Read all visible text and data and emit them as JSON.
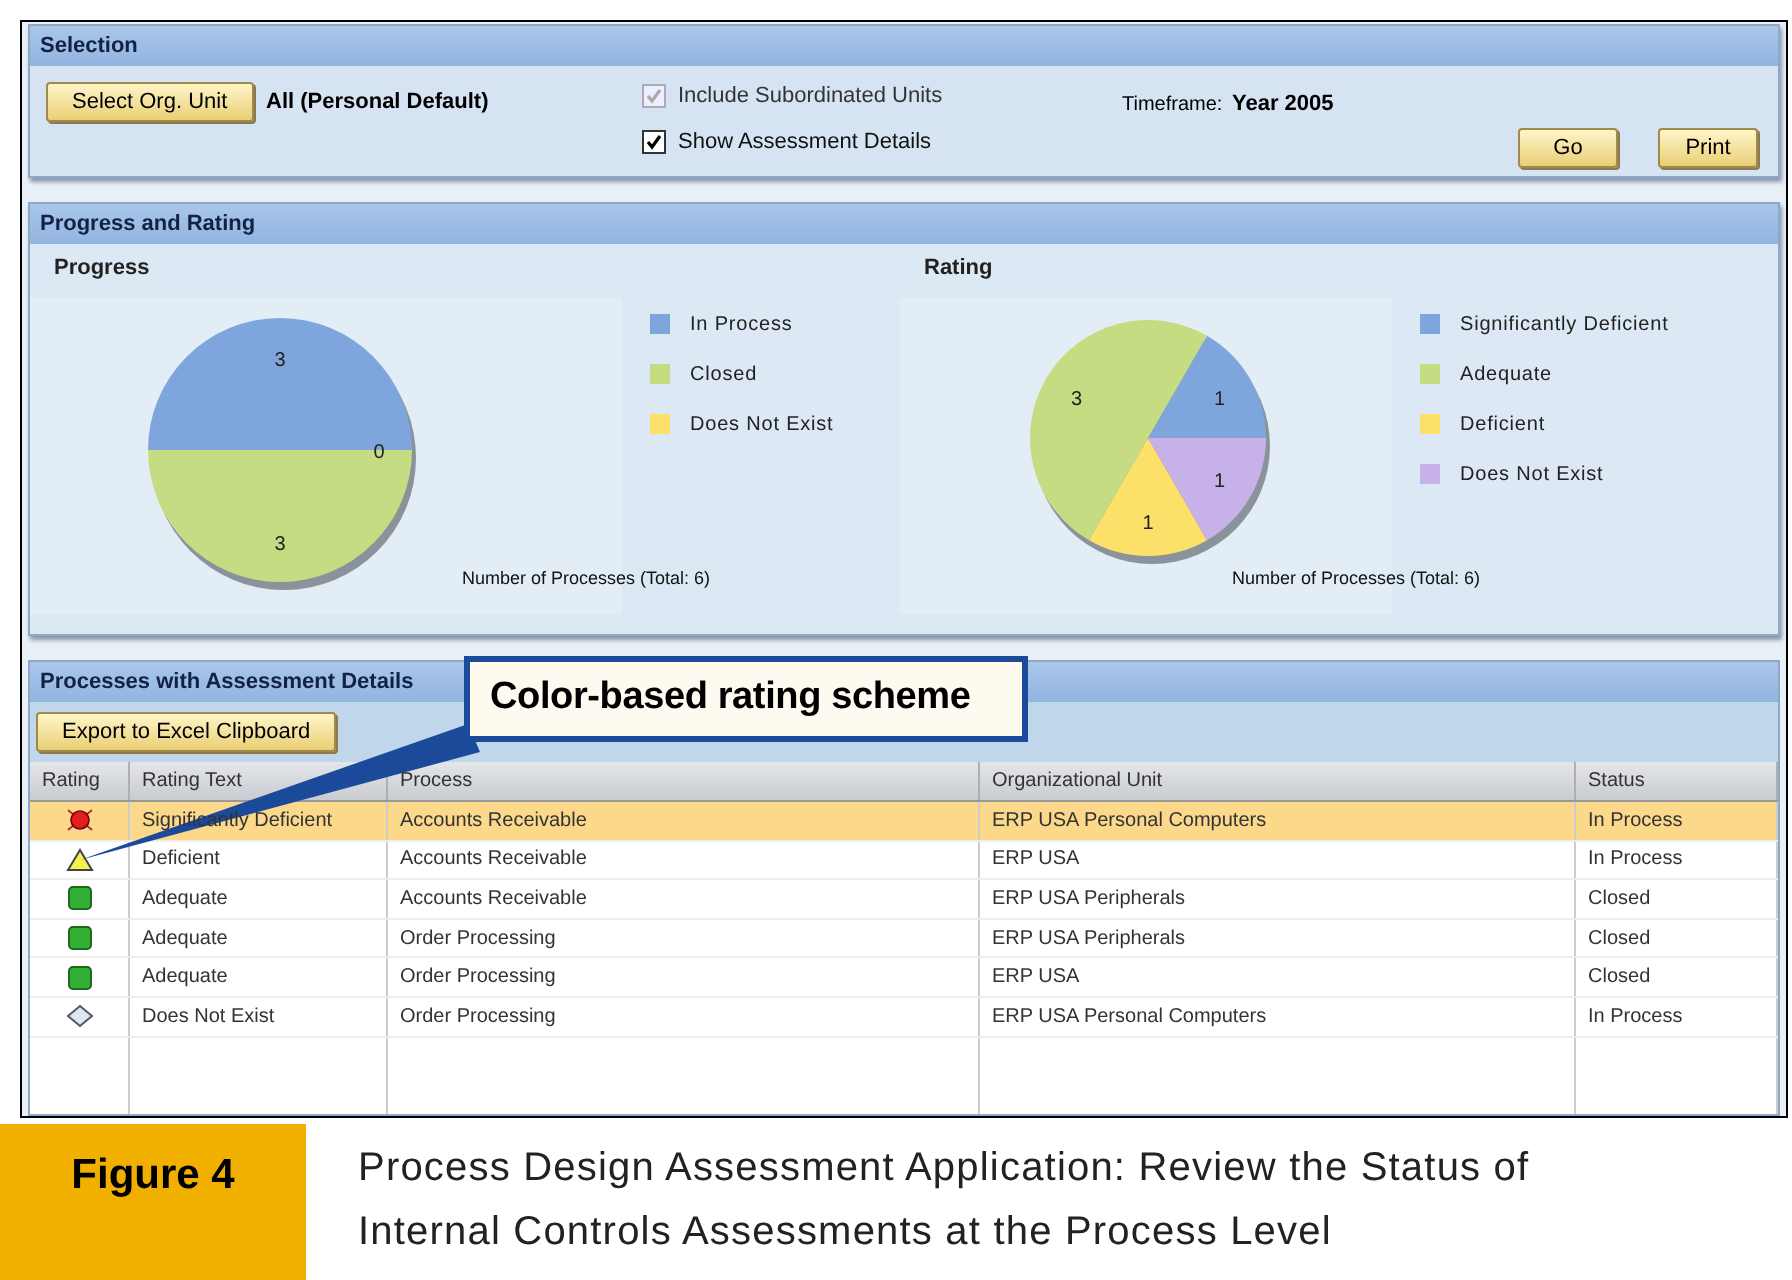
{
  "selection": {
    "title": "Selection",
    "select_button": "Select Org. Unit",
    "org_unit": "All (Personal Default)",
    "checkboxes": [
      {
        "label": "Include Subordinated Units",
        "checked": true,
        "disabled": true
      },
      {
        "label": "Show Assessment Details",
        "checked": true,
        "disabled": false
      }
    ],
    "timeframe_label": "Timeframe:",
    "timeframe_value": "Year 2005",
    "buttons": [
      "Go",
      "Print"
    ]
  },
  "progress_rating": {
    "title": "Progress and Rating",
    "charts": [
      {
        "chart_data": {
          "type": "pie",
          "title": "Progress",
          "xlabel": "Number of Processes (Total: 6)",
          "categories": [
            "In Process",
            "Closed",
            "Does Not Exist"
          ],
          "values": [
            3,
            3,
            0
          ],
          "colors": [
            "#7fa6dc",
            "#c6dc82",
            "#fbe16a"
          ],
          "value_labels": [
            "3",
            "3",
            "0"
          ],
          "legend": "right"
        }
      },
      {
        "chart_data": {
          "type": "pie",
          "title": "Rating",
          "xlabel": "Number of Processes (Total: 6)",
          "categories": [
            "Significantly Deficient",
            "Adequate",
            "Deficient",
            "Does Not Exist"
          ],
          "values": [
            1,
            3,
            1,
            1
          ],
          "colors": [
            "#7fa6dc",
            "#c6dc82",
            "#fbe16a",
            "#c6b2e8"
          ],
          "value_labels": [
            "1",
            "3",
            "1",
            "1"
          ],
          "legend": "right"
        }
      }
    ]
  },
  "processes": {
    "title": "Processes with Assessment Details",
    "export_button": "Export to Excel Clipboard",
    "columns": [
      "Rating",
      "Rating Text",
      "Process",
      "Organizational Unit",
      "Status"
    ],
    "rows": [
      {
        "kind": "alarm",
        "rating_text": "Significantly Deficient",
        "process": "Accounts Receivable",
        "org_unit": "ERP USA Personal Computers",
        "status": "In Process",
        "selected": true
      },
      {
        "kind": "warning",
        "rating_text": "Deficient",
        "process": "Accounts Receivable",
        "org_unit": "ERP USA",
        "status": "In Process",
        "selected": false
      },
      {
        "kind": "ok",
        "rating_text": "Adequate",
        "process": "Accounts Receivable",
        "org_unit": "ERP USA Peripherals",
        "status": "Closed",
        "selected": false
      },
      {
        "kind": "ok",
        "rating_text": "Adequate",
        "process": "Order Processing",
        "org_unit": "ERP USA Peripherals",
        "status": "Closed",
        "selected": false
      },
      {
        "kind": "ok",
        "rating_text": "Adequate",
        "process": "Order Processing",
        "org_unit": "ERP USA",
        "status": "Closed",
        "selected": false
      },
      {
        "kind": "none",
        "rating_text": "Does Not Exist",
        "process": "Order Processing",
        "org_unit": "ERP USA Personal Computers",
        "status": "In Process",
        "selected": false
      }
    ]
  },
  "callout": "Color-based rating scheme",
  "caption": {
    "label": "Figure 4",
    "text": "Process Design Assessment Application: Review the Status of Internal Controls Assessments at the Process Level"
  }
}
